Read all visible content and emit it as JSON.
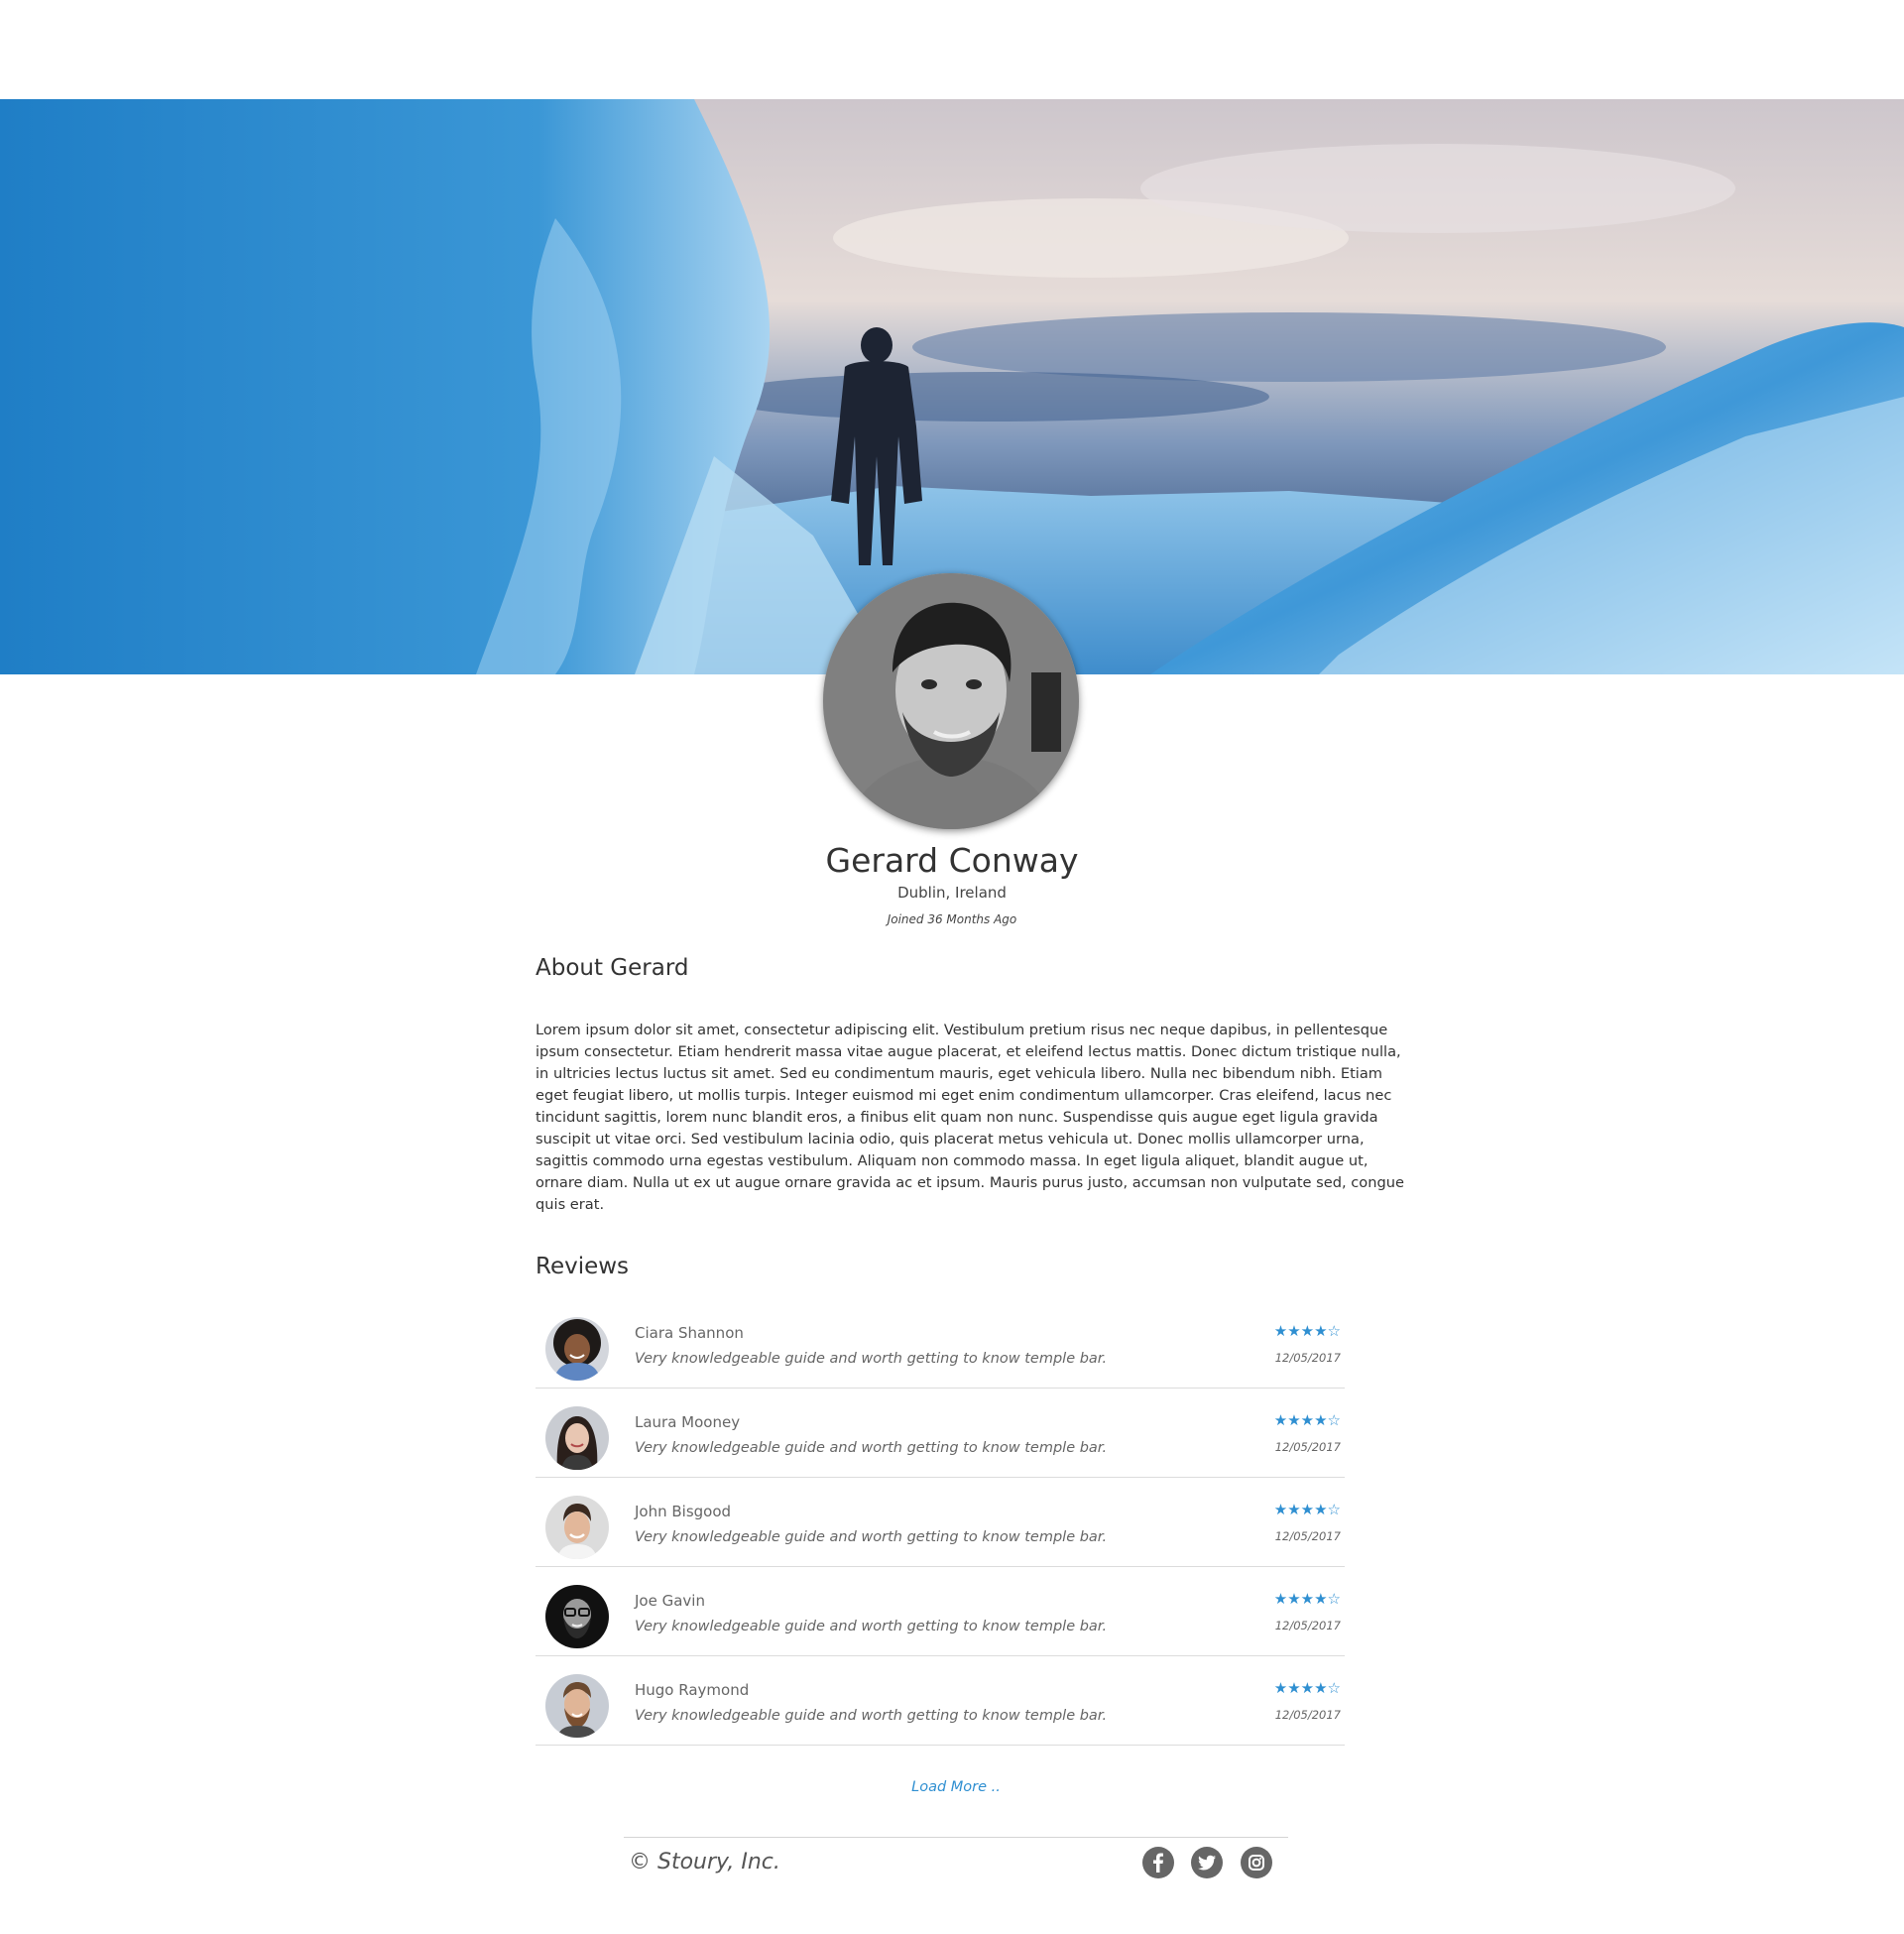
{
  "profile": {
    "name": "Gerard Conway",
    "location": "Dublin, Ireland",
    "joined": "Joined 36 Months Ago"
  },
  "about": {
    "heading": "About Gerard",
    "text": "Lorem ipsum dolor sit amet, consectetur adipiscing elit. Vestibulum pretium risus nec neque dapibus, in pellentesque ipsum consectetur. Etiam hendrerit massa vitae augue placerat, et eleifend lectus mattis. Donec dictum tristique nulla, in ultricies lectus luctus sit amet. Sed eu condimentum mauris, eget vehicula libero. Nulla nec bibendum nibh. Etiam eget feugiat libero, ut mollis turpis. Integer euismod mi eget enim condimentum ullamcorper. Cras eleifend, lacus nec tincidunt sagittis, lorem nunc blandit eros, a finibus elit quam non nunc. Suspendisse quis augue eget ligula gravida suscipit ut vitae orci. Sed vestibulum lacinia odio, quis placerat metus vehicula ut. Donec mollis ullamcorper urna, sagittis commodo urna egestas vestibulum. Aliquam non commodo massa. In eget ligula aliquet, blandit augue ut, ornare diam. Nulla ut ex ut augue ornare gravida ac et ipsum. Mauris purus justo, accumsan non vulputate sed, congue quis erat."
  },
  "reviews": {
    "heading": "Reviews",
    "items": [
      {
        "name": "Ciara Shannon",
        "text": "Very knowledgeable guide and worth getting to know temple bar.",
        "stars": "★★★★☆",
        "rating": 4,
        "date": "12/05/2017"
      },
      {
        "name": "Laura Mooney",
        "text": "Very knowledgeable guide and worth getting to know temple bar.",
        "stars": "★★★★☆",
        "rating": 4,
        "date": "12/05/2017"
      },
      {
        "name": "John Bisgood",
        "text": "Very knowledgeable guide and worth getting to know temple bar.",
        "stars": "★★★★☆",
        "rating": 4,
        "date": "12/05/2017"
      },
      {
        "name": "Joe Gavin",
        "text": "Very knowledgeable guide and worth getting to know temple bar.",
        "stars": "★★★★☆",
        "rating": 4,
        "date": "12/05/2017"
      },
      {
        "name": "Hugo Raymond",
        "text": "Very knowledgeable guide and worth getting to know temple bar.",
        "stars": "★★★★☆",
        "rating": 4,
        "date": "12/05/2017"
      }
    ],
    "load_more": "Load More .."
  },
  "footer": {
    "copyright": "©  Stoury, Inc.",
    "social": [
      "facebook-icon",
      "twitter-icon",
      "instagram-icon"
    ]
  },
  "colors": {
    "accent": "#2f8fd1",
    "text": "#333333",
    "muted": "#666666"
  }
}
